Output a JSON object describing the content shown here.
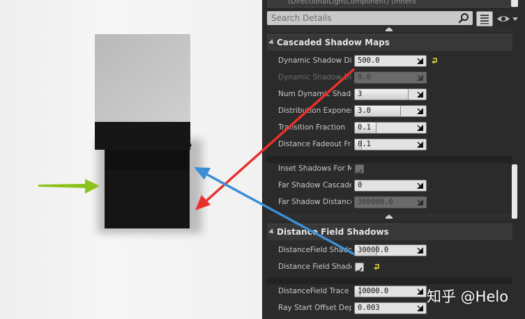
{
  "details": {
    "top_strip_text": "(DirectionalLightComponent) (Inherit",
    "search": {
      "placeholder": "Search Details",
      "value": ""
    },
    "cascaded": {
      "title": "Cascaded Shadow Maps",
      "props": [
        {
          "label": "Dynamic Shadow Dis",
          "value": "500.0",
          "fill": 0.0,
          "disabled": false,
          "reset": true
        },
        {
          "label": "Dynamic Shadow Dis",
          "value": "0.0",
          "fill": 0.0,
          "disabled": true,
          "reset": false
        },
        {
          "label": "Num Dynamic Shado",
          "value": "3",
          "fill": 0.75,
          "disabled": false,
          "reset": false
        },
        {
          "label": "Distribution Exponent",
          "value": "3.0",
          "fill": 0.65,
          "disabled": false,
          "reset": false
        },
        {
          "label": "Transition Fraction",
          "value": "0.1",
          "fill": 0.3,
          "disabled": false,
          "reset": false
        },
        {
          "label": "Distance Fadeout Fra",
          "value": "0.1",
          "fill": 0.1,
          "disabled": false,
          "reset": false
        }
      ],
      "inset_label": "Inset Shadows For M",
      "inset_checked": true,
      "far_cascade_label": "Far Shadow Cascade",
      "far_cascade_value": "0",
      "far_distance_label": "Far Shadow Distance",
      "far_distance_value": "300000.0"
    },
    "distance_field": {
      "title": "Distance Field Shadows",
      "df_shadow_label": "DistanceField Shado",
      "df_shadow_value": "30000.0",
      "df_shadow2_label": "Distance Field Shado",
      "df_shadow2_checked": true,
      "trace_label": "DistanceField Trace I",
      "trace_value": "10000.0",
      "ray_label": "Ray Start Offset Dep",
      "ray_value": "0.003"
    }
  },
  "colors": {
    "red_arrow": "#e8302c",
    "blue_arrow": "#3a8fd8",
    "green_arrow": "#8cc21a",
    "reset_yellow": "#e8d33a"
  },
  "watermark": "知乎 @Helo"
}
